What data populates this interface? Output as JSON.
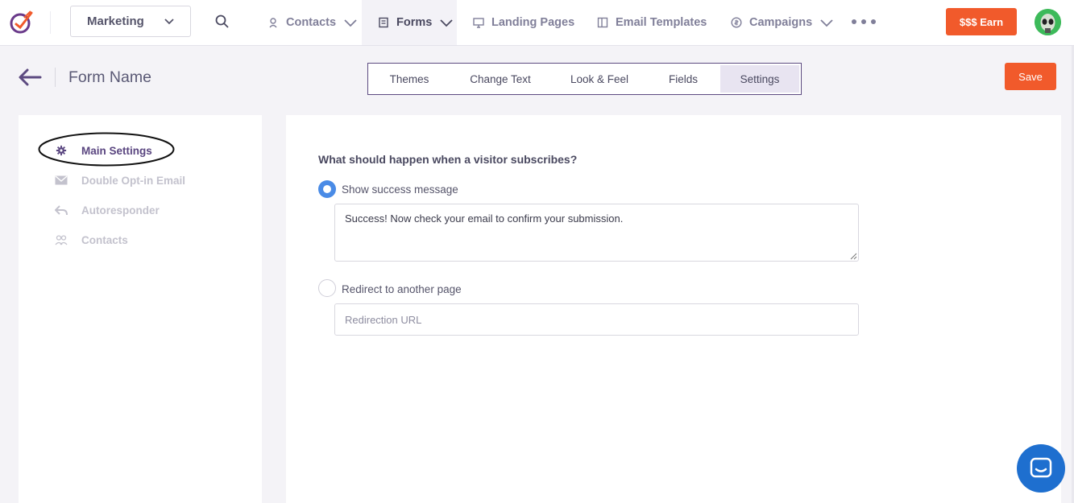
{
  "nav": {
    "workspace": "Marketing",
    "items": [
      {
        "label": "Contacts",
        "icon": "user-icon"
      },
      {
        "label": "Forms",
        "icon": "form-icon"
      },
      {
        "label": "Landing Pages",
        "icon": "monitor-icon"
      },
      {
        "label": "Email Templates",
        "icon": "template-icon"
      },
      {
        "label": "Campaigns",
        "icon": "campaign-icon"
      }
    ],
    "earn_label": "$$$ Earn"
  },
  "header": {
    "title": "Form Name",
    "tabs": [
      "Themes",
      "Change Text",
      "Look & Feel",
      "Fields",
      "Settings"
    ],
    "active_tab": "Settings",
    "save_label": "Save"
  },
  "sidebar": {
    "items": [
      {
        "label": "Main Settings",
        "icon": "gear-icon"
      },
      {
        "label": "Double Opt-in Email",
        "icon": "mail-icon"
      },
      {
        "label": "Autoresponder",
        "icon": "reply-icon"
      },
      {
        "label": "Contacts",
        "icon": "users-icon"
      }
    ]
  },
  "settings": {
    "question": "What should happen when a visitor subscribes?",
    "option_success": "Show success message",
    "success_message": "Success! Now check your email to confirm your submission.",
    "option_redirect": "Redirect to another page",
    "redirect_placeholder": "Redirection URL"
  },
  "colors": {
    "accent": "#f15a2b",
    "brand_purple": "#5c4a80",
    "radio_selected": "#4a8be6",
    "chat": "#1e6fcf"
  }
}
